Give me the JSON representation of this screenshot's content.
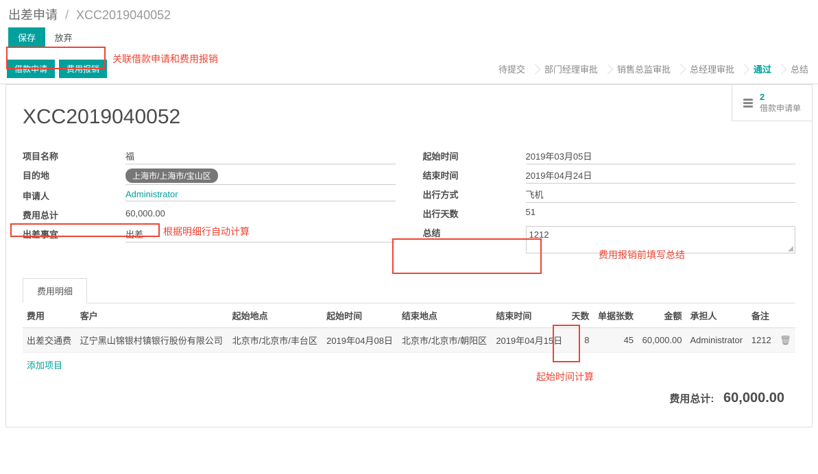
{
  "breadcrumb": {
    "main": "出差申请",
    "current": "XCC2019040052"
  },
  "toolbar": {
    "save": "保存",
    "discard": "放弃"
  },
  "actions": {
    "loan": "借款申请",
    "expense": "费用报销"
  },
  "annotations": {
    "link_note": "关联借款申请和费用报销",
    "total_note": "根据明细行自动计算",
    "summary_note": "费用报销前填写总结",
    "days_note": "起始时间计算"
  },
  "status": {
    "steps": [
      "待提交",
      "部门经理审批",
      "销售总监审批",
      "总经理审批",
      "通过",
      "总结"
    ],
    "active_index": 4
  },
  "stat": {
    "count": "2",
    "label": "借款申请单"
  },
  "record": {
    "title": "XCC2019040052"
  },
  "left_fields": {
    "project_label": "项目名称",
    "project_value": "福",
    "dest_label": "目的地",
    "dest_value": "上海市/上海市/宝山区",
    "applicant_label": "申请人",
    "applicant_value": "Administrator",
    "total_label": "费用总计",
    "total_value": "60,000.00",
    "reason_label": "出差事宜",
    "reason_value": "出差"
  },
  "right_fields": {
    "start_label": "起始时间",
    "start_value": "2019年03月05日",
    "end_label": "结束时间",
    "end_value": "2019年04月24日",
    "mode_label": "出行方式",
    "mode_value": "飞机",
    "days_label": "出行天数",
    "days_value": "51",
    "summary_label": "总结",
    "summary_value": "1212"
  },
  "tab": {
    "label": "费用明细"
  },
  "table": {
    "headers": {
      "fee": "费用",
      "customer": "客户",
      "start_loc": "起始地点",
      "start_time": "起始时间",
      "end_loc": "结束地点",
      "end_time": "结束时间",
      "days": "天数",
      "bills": "单据张数",
      "amount": "金额",
      "owner": "承担人",
      "remark": "备注"
    },
    "row": {
      "fee": "出差交通费",
      "customer": "辽宁黑山锦银村镇银行股份有限公司",
      "start_loc": "北京市/北京市/丰台区",
      "start_time": "2019年04月08日",
      "end_loc": "北京市/北京市/朝阳区",
      "end_time": "2019年04月15日",
      "days": "8",
      "bills": "45",
      "amount": "60,000.00",
      "owner": "Administrator",
      "remark": "1212"
    },
    "add_line": "添加项目",
    "footer_label": "费用总计:",
    "footer_value": "60,000.00"
  }
}
